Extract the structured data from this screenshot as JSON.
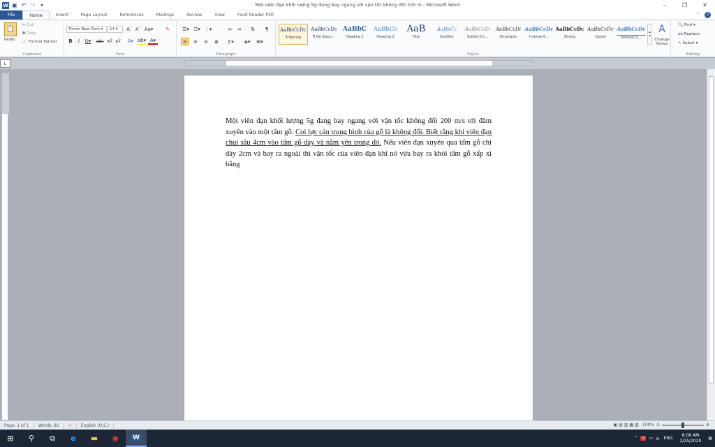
{
  "window": {
    "title": "Một viên đạn khối lượng 5g đang bay ngang với vận tốc không đổi 200 m - Microsoft Word"
  },
  "tabs": [
    "File",
    "Home",
    "Insert",
    "Page Layout",
    "References",
    "Mailings",
    "Review",
    "View",
    "Foxit Reader PDF"
  ],
  "active_tab": "Home",
  "clipboard": {
    "paste": "Paste",
    "cut": "Cut",
    "copy": "Copy",
    "format_painter": "Format Painter",
    "label": "Clipboard"
  },
  "font": {
    "name": "Times New Rom",
    "size": "14",
    "label": "Font"
  },
  "paragraph": {
    "label": "Paragraph"
  },
  "styles": {
    "items": [
      {
        "preview": "AaBbCcDc",
        "name": "¶ Normal"
      },
      {
        "preview": "AaBbCcDc",
        "name": "¶ No Spaci..."
      },
      {
        "preview": "AaBbC",
        "name": "Heading 1"
      },
      {
        "preview": "AaBbCc",
        "name": "Heading 2"
      },
      {
        "preview": "AaB",
        "name": "Title"
      },
      {
        "preview": "AaBbCc",
        "name": "Subtitle"
      },
      {
        "preview": "AaBbCcDi",
        "name": "Subtle Em..."
      },
      {
        "preview": "AaBbCcDi",
        "name": "Emphasis"
      },
      {
        "preview": "AaBbCcDc",
        "name": "Intense E..."
      },
      {
        "preview": "AaBbCcDc",
        "name": "Strong"
      },
      {
        "preview": "AaBbCcDc",
        "name": "Quote"
      },
      {
        "preview": "AaBbCcDc",
        "name": "Intense Q..."
      }
    ],
    "change": "Change Styles",
    "label": "Styles"
  },
  "editing": {
    "find": "Find",
    "replace": "Replace",
    "select": "Select",
    "label": "Editing"
  },
  "document": {
    "part1": "Một viên đạn khối lượng 5g đang bay ngang với vận tốc không đổi 200 m/s tới đâm xuyên vào một tấm gỗ. ",
    "part2": "Coi lực cản trung bình của gỗ là không đổi. Biết rằng khi viên đạn chui sâu 4cm vào tấm gỗ dày và nằm yên trong đó.",
    "part3": " Nếu viên đạn xuyên qua tấm gỗ chỉ dày 2cm và bay ra ngoài thì vận tốc của viên đạn khi nó vừa bay ra khỏi tấm gỗ xấp xỉ bằng"
  },
  "status": {
    "page": "Page: 1 of 1",
    "words": "Words: 81",
    "language": "English (U.S.)",
    "zoom": "100%"
  },
  "taskbar": {
    "language": "ENG",
    "time": "8:06 AM",
    "date": "2/25/2020"
  },
  "colors": {
    "file_tab": "#2b579a",
    "taskbar": "#1b2636"
  }
}
